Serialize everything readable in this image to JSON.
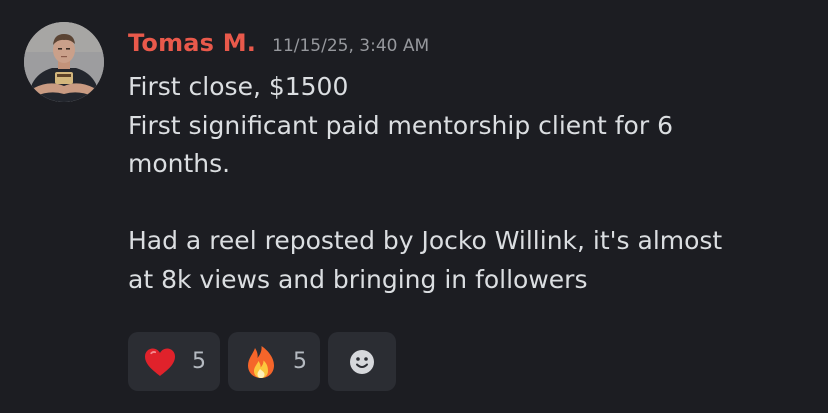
{
  "message": {
    "author": "Tomas M.",
    "timestamp": "11/15/25, 3:40 AM",
    "lines": [
      "First close, $1500",
      "First significant paid mentorship client for 6",
      "months.",
      "",
      "Had a reel reposted by Jocko Willink, it's almost",
      "at 8k views and bringing in followers"
    ]
  },
  "reactions": [
    {
      "icon": "heart-emoji",
      "count": "5"
    },
    {
      "icon": "fire-emoji",
      "count": "5"
    }
  ],
  "add_reaction": {
    "icon": "smiley-icon"
  },
  "colors": {
    "background": "#1c1d22",
    "author": "#e9594b",
    "timestamp": "#96989d",
    "text": "#dbdee1",
    "reaction_bg": "#2b2d33",
    "reaction_count": "#b5bac1"
  }
}
